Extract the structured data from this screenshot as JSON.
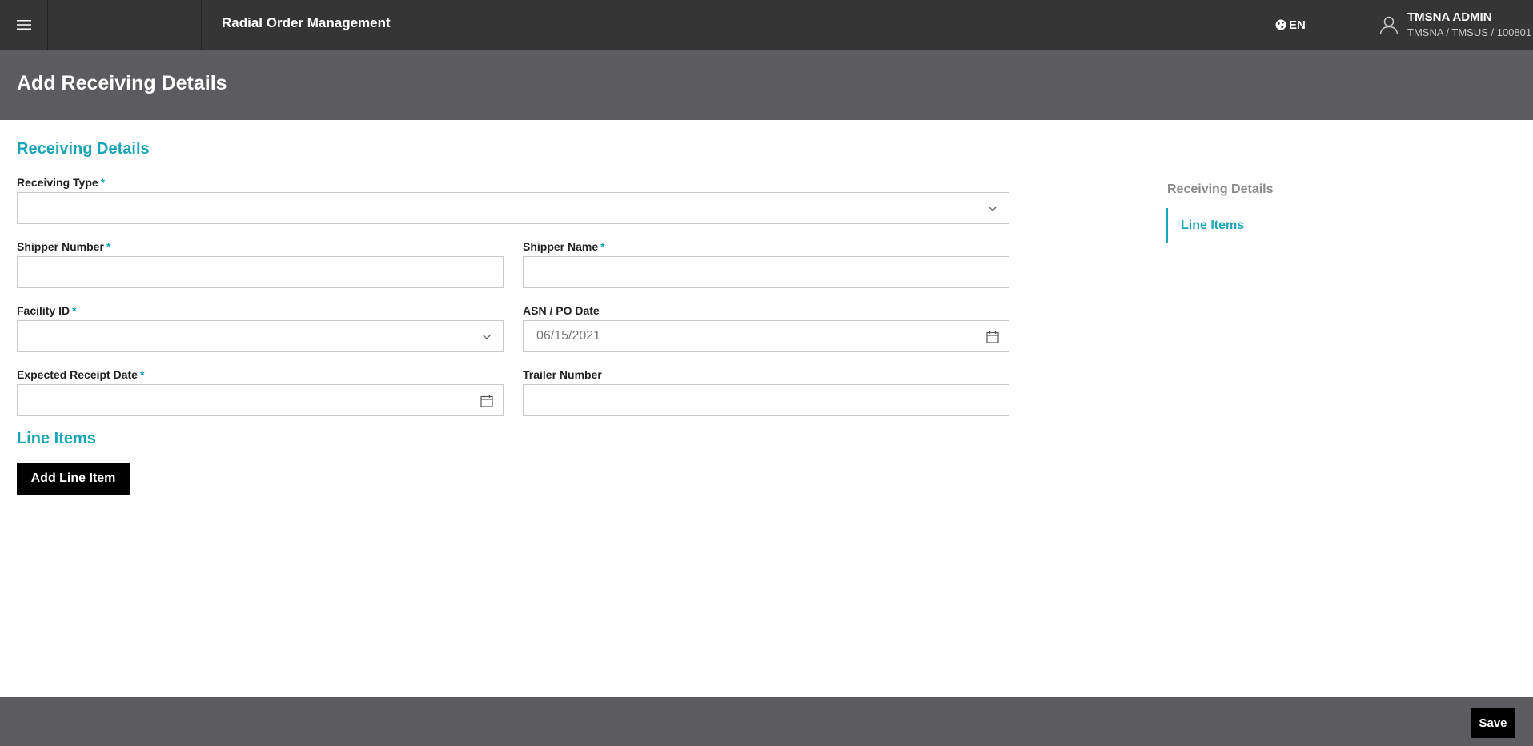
{
  "header": {
    "app_title": "Radial Order Management",
    "language": "EN",
    "user_name": "TMSNA ADMIN",
    "user_context": "TMSNA / TMSUS / 100801"
  },
  "page": {
    "title": "Add Receiving Details"
  },
  "receiving_details": {
    "section_title": "Receiving Details",
    "required_marker": "*",
    "fields": {
      "receiving_type": {
        "label": "Receiving Type",
        "value": ""
      },
      "shipper_number": {
        "label": "Shipper Number",
        "value": ""
      },
      "shipper_name": {
        "label": "Shipper Name",
        "value": ""
      },
      "facility_id": {
        "label": "Facility ID",
        "value": ""
      },
      "asn_po_date": {
        "label": "ASN / PO Date",
        "value": "06/15/2021"
      },
      "expected_receipt_date": {
        "label": "Expected Receipt Date",
        "value": ""
      },
      "trailer_number": {
        "label": "Trailer Number",
        "value": ""
      }
    }
  },
  "line_items": {
    "section_title": "Line Items",
    "add_button_label": "Add Line Item"
  },
  "side_nav": {
    "items": [
      {
        "label": "Receiving Details",
        "active": false
      },
      {
        "label": "Line Items",
        "active": true
      }
    ]
  },
  "footer": {
    "save_label": "Save"
  },
  "colors": {
    "topbar": "#353535",
    "page_header": "#5b5b60",
    "accent": "#1aa6b7",
    "button": "#000000"
  },
  "icons": {
    "menu": "hamburger-icon",
    "language": "globe-icon",
    "user": "user-icon",
    "dropdown": "chevron-down-icon",
    "date": "calendar-icon"
  }
}
